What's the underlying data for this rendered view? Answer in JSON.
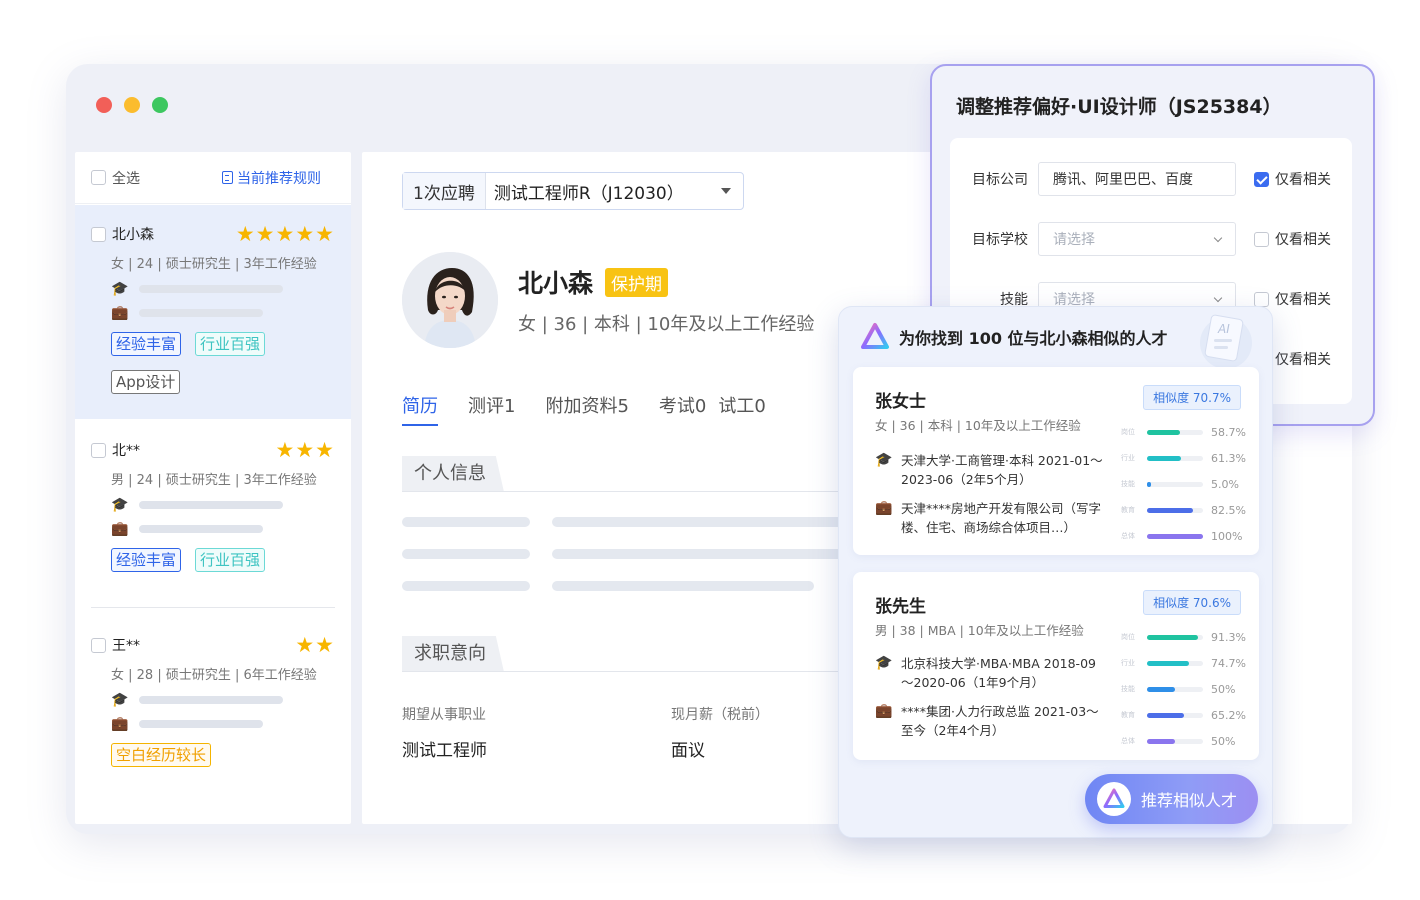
{
  "colors": {
    "dot_red": "#f25f58",
    "dot_yellow": "#fbbc2e",
    "dot_green": "#3dc760",
    "accent_blue": "#2f64e8",
    "star": "#f7b500",
    "protect": "#f8c313"
  },
  "list": {
    "select_all": "全选",
    "rule_link": "当前推荐规则",
    "candidates": [
      {
        "name": "北小森",
        "rating": 5,
        "stars": "★★★★★",
        "meta": "女 | 24 | 硕士研究生 | 3年工作经验",
        "tags": [
          {
            "label": "经验丰富",
            "style": "blue"
          },
          {
            "label": "行业百强",
            "style": "teal"
          },
          {
            "label": "App设计",
            "style": "gray"
          }
        ]
      },
      {
        "name": "北**",
        "rating": 3,
        "stars": "★★★",
        "meta": "男 | 24 | 硕士研究生 | 3年工作经验",
        "tags": [
          {
            "label": "经验丰富",
            "style": "blue"
          },
          {
            "label": "行业百强",
            "style": "teal"
          }
        ]
      },
      {
        "name": "王**",
        "rating": 2,
        "stars": "★★",
        "meta": "女 | 28 | 硕士研究生 | 6年工作经验",
        "tags": [
          {
            "label": "空白经历较长",
            "style": "orange"
          }
        ]
      }
    ]
  },
  "detail": {
    "apply_count": "1次应聘",
    "apply_job": "测试工程师R（J12030）",
    "name": "北小森",
    "protect_badge": "保护期",
    "meta": "女 | 36 | 本科 | 10年及以上工作经验",
    "tabs": [
      "简历",
      "测评1",
      "附加资料5",
      "考试0",
      "试工0"
    ],
    "section_personal": "个人信息",
    "section_intent": "求职意向",
    "field_job_label": "期望从事职业",
    "field_job_value": "测试工程师",
    "field_salary_label": "现月薪（税前）",
    "field_salary_value": "面议"
  },
  "pref": {
    "title": "调整推荐偏好·UI设计师（JS25384）",
    "rows": [
      {
        "label": "目标公司",
        "value": "腾讯、阿里巴巴、百度",
        "placeholder": false,
        "only": "仅看相关",
        "checked": true
      },
      {
        "label": "目标学校",
        "value": "请选择",
        "placeholder": true,
        "only": "仅看相关",
        "checked": false
      },
      {
        "label": "技能",
        "value": "请选择",
        "placeholder": true,
        "only": "仅看相关",
        "checked": false
      },
      {
        "label": "",
        "value": "",
        "placeholder": true,
        "only": "仅看相关",
        "checked": false
      }
    ]
  },
  "similar": {
    "heading": "为你找到 100 位与北小森相似的人才",
    "ai_badge": "AI",
    "cards": [
      {
        "name": "张女士",
        "similarity": "相似度 70.7%",
        "meta": "女 | 36 | 本科 | 10年及以上工作经验",
        "education": "天津大学·工商管理·本科 2021-01～2023-06（2年5个月）",
        "work": "天津****房地产开发有限公司（写字楼、住宅、商场综合体项目…）",
        "scores": [
          {
            "label": "岗位",
            "value": 58.7,
            "text": "58.7%",
            "color": "#1fc3a0"
          },
          {
            "label": "行业",
            "value": 61.3,
            "text": "61.3%",
            "color": "#22bfc6"
          },
          {
            "label": "技能",
            "value": 5.0,
            "text": "5.0%",
            "color": "#2f8fe8"
          },
          {
            "label": "教育",
            "value": 82.5,
            "text": "82.5%",
            "color": "#4c6ee8"
          },
          {
            "label": "总体",
            "value": 100,
            "text": "100%",
            "color": "#8a75ee"
          }
        ]
      },
      {
        "name": "张先生",
        "similarity": "相似度 70.6%",
        "meta": "男 | 38 | MBA | 10年及以上工作经验",
        "education": "北京科技大学·MBA·MBA 2018-09～2020-06（1年9个月）",
        "work": "****集团·人力行政总监 2021-03～至今（2年4个月）",
        "scores": [
          {
            "label": "岗位",
            "value": 91.3,
            "text": "91.3%",
            "color": "#1fc3a0"
          },
          {
            "label": "行业",
            "value": 74.7,
            "text": "74.7%",
            "color": "#22bfc6"
          },
          {
            "label": "技能",
            "value": 50,
            "text": "50%",
            "color": "#2f8fe8"
          },
          {
            "label": "教育",
            "value": 65.2,
            "text": "65.2%",
            "color": "#4c6ee8"
          },
          {
            "label": "总体",
            "value": 50,
            "text": "50%",
            "color": "#8a75ee"
          }
        ]
      }
    ],
    "button": "推荐相似人才"
  }
}
